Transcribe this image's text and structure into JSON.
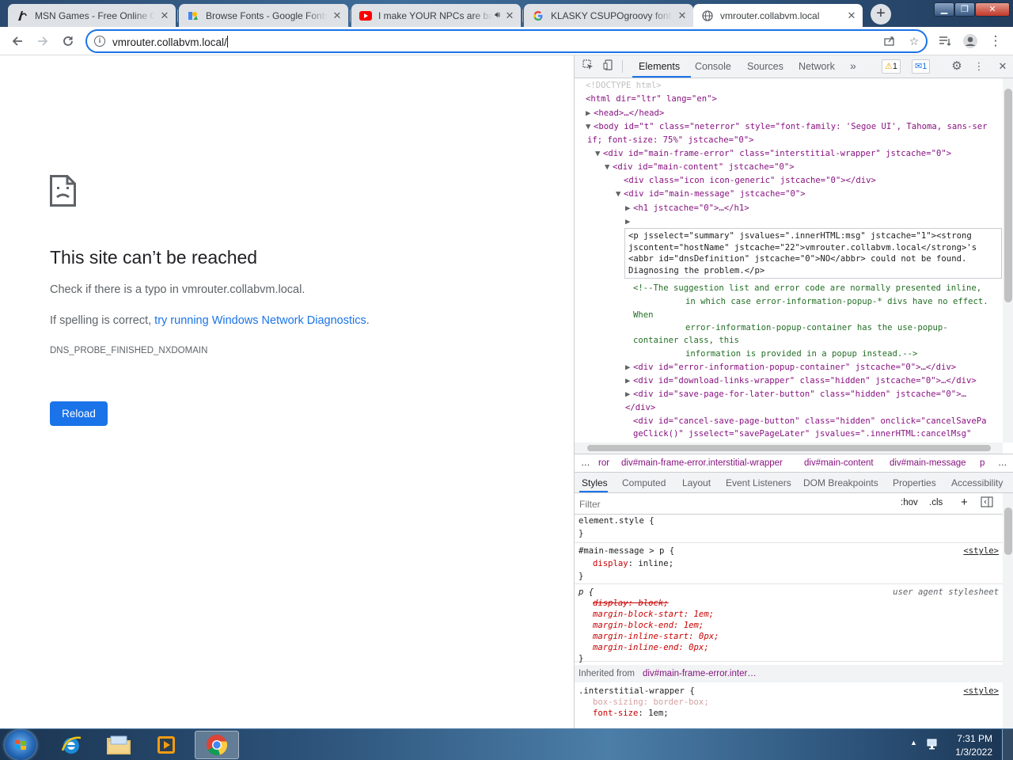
{
  "tabs": [
    {
      "title": "MSN Games - Free Online Games",
      "favicon": "msn-games-icon",
      "active": false
    },
    {
      "title": "Browse Fonts - Google Fonts",
      "favicon": "google-fonts-icon",
      "active": false
    },
    {
      "title": "I make YOUR NPCs are back",
      "favicon": "youtube-icon",
      "active": false,
      "audio": true
    },
    {
      "title": "KLASKY CSUPOgroovy font - Google Search",
      "favicon": "google-icon",
      "active": false
    },
    {
      "title": "vmrouter.collabvm.local",
      "favicon": "globe-icon",
      "active": true
    }
  ],
  "address_bar": {
    "url": "vmrouter.collabvm.local/"
  },
  "error_page": {
    "title": "This site can’t be reached",
    "line1_prefix": "Check if there is a typo in ",
    "line1_host": "vmrouter.collabvm.local",
    "line1_suffix": ".",
    "line2_prefix": "If spelling is correct, ",
    "line2_link": "try running Windows Network Diagnostics",
    "line2_suffix": ".",
    "error_code": "DNS_PROBE_FINISHED_NXDOMAIN",
    "reload_label": "Reload"
  },
  "devtools": {
    "tabs": [
      "Elements",
      "Console",
      "Sources",
      "Network"
    ],
    "more": "»",
    "warnings": "1",
    "messages": "1",
    "dom_lines": [
      "<!DOCTYPE html>",
      "<html dir=\"ltr\" lang=\"en\">",
      "<head>…</head>",
      "<body id=\"t\" class=\"neterror\" style=\"font-family: 'Segoe UI', Tahoma, sans-ser",
      "if; font-size: 75%\" jstcache=\"0\">",
      "<div id=\"main-frame-error\" class=\"interstitial-wrapper\" jstcache=\"0\">",
      "<div id=\"main-content\" jstcache=\"0\">",
      "<div class=\"icon icon-generic\" jstcache=\"0\"></div>",
      "<div id=\"main-message\" jstcache=\"0\">",
      "<h1 jstcache=\"0\">…</h1>",
      "<!--The suggestion list and error code are normally presented inline,",
      "in which case error-information-popup-* divs have no effect.",
      "When",
      "error-information-popup-container has the use-popup-",
      "container class, this",
      "information is provided in a popup instead.-->",
      "<div id=\"error-information-popup-container\" jstcache=\"0\">…</div>",
      "<div id=\"download-links-wrapper\" class=\"hidden\" jstcache=\"0\">…</div>",
      "<div id=\"save-page-for-later-button\" class=\"hidden\" jstcache=\"0\">…",
      "</div>",
      "<div id=\"cancel-save-page-button\" class=\"hidden\" onclick=\"cancelSavePa",
      "geClick()\" jsselect=\"savePageLater\" jsvalues=\".innerHTML:cancelMsg\""
    ],
    "selected_node": [
      "<p jsselect=\"summary\" jsvalues=\".innerHTML:msg\" jstcache=\"1\"><strong",
      "jscontent=\"hostName\" jstcache=\"22\">vmrouter.collabvm.local</strong>'s",
      "<abbr id=\"dnsDefinition\" jstcache=\"0\">NO</abbr> could not be found.",
      "Diagnosing the problem.</p>"
    ],
    "breadcrumbs": [
      "…",
      "ror",
      "div#main-frame-error.interstitial-wrapper",
      "div#main-content",
      "div#main-message",
      "p",
      "…"
    ],
    "sub_tabs": [
      "Styles",
      "Computed",
      "Layout",
      "Event Listeners",
      "DOM Breakpoints",
      "Properties",
      "Accessibility"
    ],
    "filter_placeholder": "Filter",
    "filter_buttons": [
      ":hov",
      ".cls",
      "+"
    ],
    "styles": {
      "element_style": "element.style {",
      "close": "}",
      "rule1_selector": "#main-message > p {",
      "rule1_source": "<style>",
      "rule1_prop": "display",
      "rule1_value": "inline;",
      "rule2_selector": "p {",
      "rule2_source": "user agent stylesheet",
      "rule2_lines": [
        "display: block;",
        "margin-block-start: 1em;",
        "margin-block-end: 1em;",
        "margin-inline-start: 0px;",
        "margin-inline-end: 0px;"
      ],
      "inherited_label": "Inherited from",
      "inherited_from": "div#main-frame-error.inter…",
      "rule3_selector": ".interstitial-wrapper {",
      "rule3_source": "<style>",
      "rule3_line1": "box-sizing: border-box;",
      "rule3_line2_prop": "font-size",
      "rule3_line2_value": "1em;"
    }
  },
  "taskbar": {
    "time": "7:31 PM",
    "date": "1/3/2022"
  }
}
